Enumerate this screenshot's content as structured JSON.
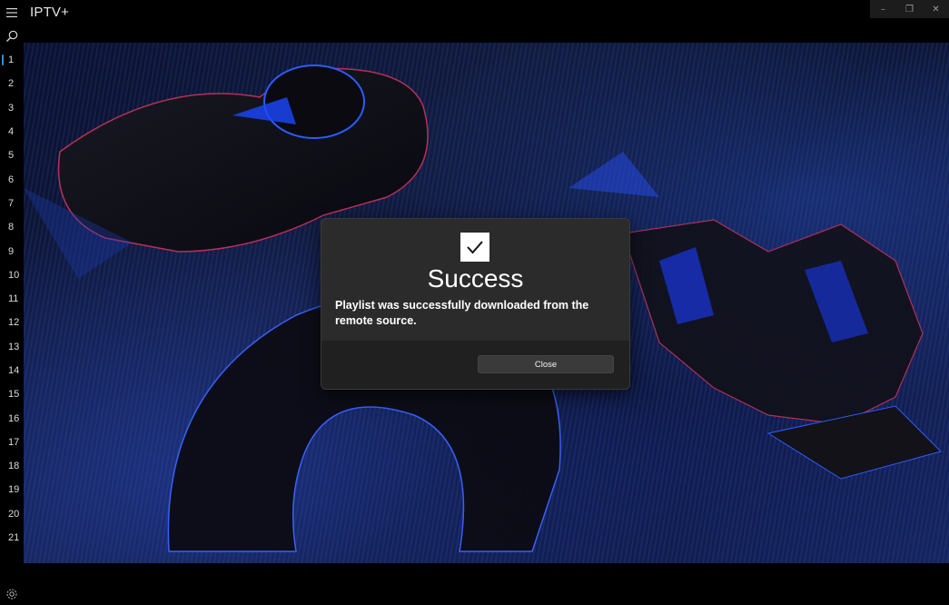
{
  "window": {
    "title": "IPTV+",
    "controls": {
      "minimize": "–",
      "restore": "❐",
      "close": "✕"
    }
  },
  "rail": {
    "channels": [
      "1",
      "2",
      "3",
      "4",
      "5",
      "6",
      "7",
      "8",
      "9",
      "10",
      "11",
      "12",
      "13",
      "14",
      "15",
      "16",
      "17",
      "18",
      "19",
      "20",
      "21"
    ],
    "active_channel": "1"
  },
  "dialog": {
    "title": "Success",
    "message": "Playlist was successfully downloaded from the remote source.",
    "close_label": "Close"
  },
  "icons": {
    "menu": "hamburger-icon",
    "search": "search-icon",
    "settings": "gear-icon",
    "success": "checkmark-icon"
  },
  "colors": {
    "accent": "#2e8fd6",
    "dialog_bg": "#2b2b2b",
    "dialog_footer_bg": "#202020"
  }
}
